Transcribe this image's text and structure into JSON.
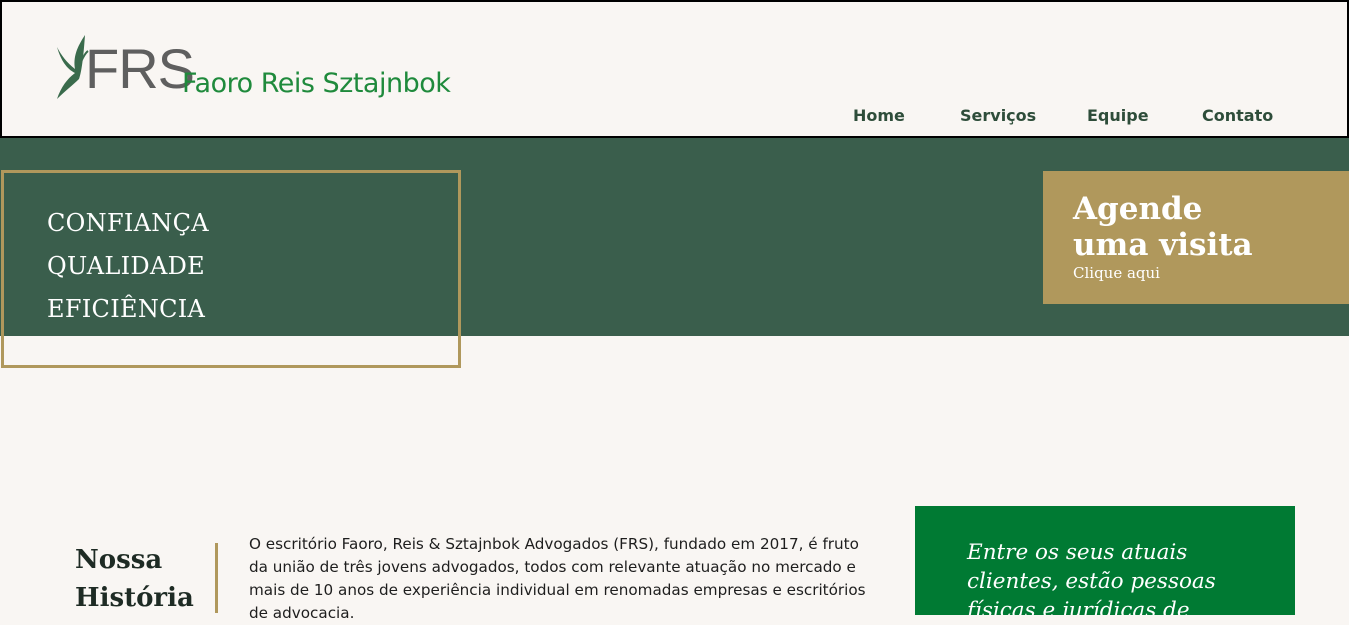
{
  "brand": {
    "abbr": "FRS",
    "name": "Faoro Reis Sztajnbok",
    "colors": {
      "green": "#1f8a3c",
      "dark_green": "#3a5e4c",
      "gold": "#b0985c",
      "clients_green": "#007a33"
    }
  },
  "nav": {
    "items": [
      {
        "label": "Home"
      },
      {
        "label": "Serviços"
      },
      {
        "label": "Equipe"
      },
      {
        "label": "Contato"
      }
    ]
  },
  "hero": {
    "values": [
      "CONFIANÇA",
      "QUALIDADE",
      "EFICIÊNCIA"
    ]
  },
  "visit": {
    "title_line1": "Agende",
    "title_line2": "uma visita",
    "cta": "Clique aqui"
  },
  "history": {
    "title_line1": "Nossa",
    "title_line2": "História",
    "text": "O escritório Faoro, Reis & Sztajnbok Advogados (FRS), fundado em 2017, é fruto da união de três jovens advogados, todos com relevante atuação no mercado e mais de 10 anos de experiência individual em renomadas empresas e escritórios de advocacia."
  },
  "clients": {
    "quote": "Entre os seus atuais clientes, estão pessoas físicas e jurídicas de"
  }
}
